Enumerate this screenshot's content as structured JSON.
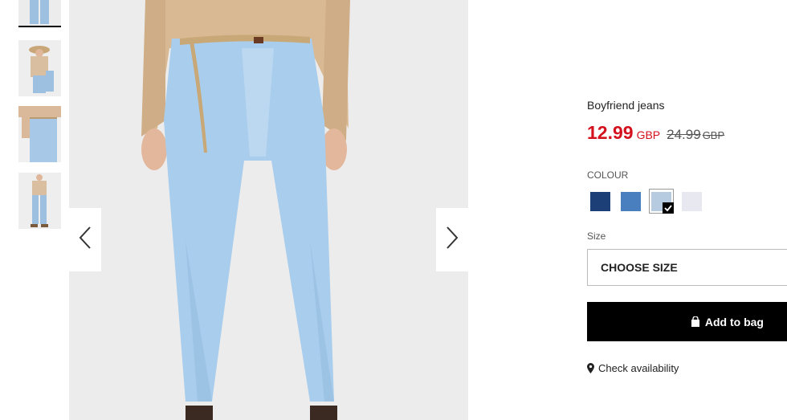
{
  "thumbnails": [
    {
      "alt": "thumbnail-1"
    },
    {
      "alt": "thumbnail-2"
    },
    {
      "alt": "thumbnail-3"
    },
    {
      "alt": "thumbnail-4"
    }
  ],
  "gallery": {
    "prev_icon": "chevron-left-icon",
    "next_icon": "chevron-right-icon"
  },
  "product": {
    "title": "Boyfriend jeans",
    "price": "12.99",
    "price_currency": "GBP",
    "old_price": "24.99",
    "old_price_currency": "GBP",
    "accent_color": "#d4121e"
  },
  "colour": {
    "label": "COLOUR",
    "swatches": [
      {
        "name": "dark-navy",
        "color": "#1c3f78"
      },
      {
        "name": "mid-blue",
        "color": "#4a7fbf"
      },
      {
        "name": "light-blue",
        "color": "#b6cbe0",
        "selected": true
      },
      {
        "name": "white",
        "color": "#e8e8f0"
      }
    ]
  },
  "size": {
    "label": "Size",
    "placeholder": "CHOOSE SIZE"
  },
  "actions": {
    "add_to_bag": "Add to bag",
    "check_availability": "Check availability"
  }
}
